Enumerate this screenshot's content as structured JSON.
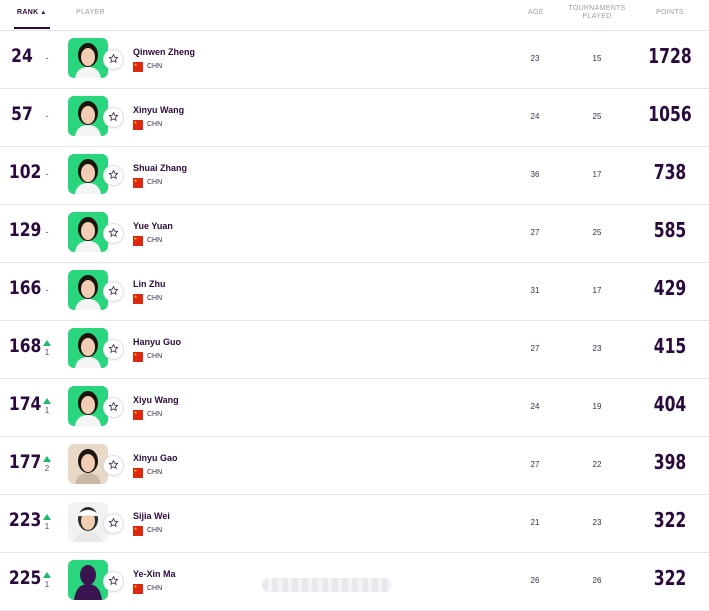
{
  "header": {
    "rank": "RANK",
    "player": "PLAYER",
    "age": "AGE",
    "tournaments_line1": "TOURNAMENTS",
    "tournaments_line2": "PLAYED",
    "points": "POINTS",
    "sort_icon": "caret-up-icon"
  },
  "colors": {
    "primary_text": "#2b0a3d",
    "green_photo_bg": "#2ad67d",
    "up_arrow": "#1fb86b",
    "flag_red": "#de2910",
    "flag_yellow": "#ffde00"
  },
  "rows": [
    {
      "rank": "24",
      "move": "-",
      "dir": "none",
      "name": "Qinwen Zheng",
      "country": "CHN",
      "age": "23",
      "tournaments": "15",
      "points": "1728",
      "photo": "green"
    },
    {
      "rank": "57",
      "move": "-",
      "dir": "none",
      "name": "Xinyu Wang",
      "country": "CHN",
      "age": "24",
      "tournaments": "25",
      "points": "1056",
      "photo": "green"
    },
    {
      "rank": "102",
      "move": "-",
      "dir": "none",
      "name": "Shuai Zhang",
      "country": "CHN",
      "age": "36",
      "tournaments": "17",
      "points": "738",
      "photo": "green"
    },
    {
      "rank": "129",
      "move": "-",
      "dir": "none",
      "name": "Yue Yuan",
      "country": "CHN",
      "age": "27",
      "tournaments": "25",
      "points": "585",
      "photo": "green"
    },
    {
      "rank": "166",
      "move": "-",
      "dir": "none",
      "name": "Lin Zhu",
      "country": "CHN",
      "age": "31",
      "tournaments": "17",
      "points": "429",
      "photo": "green"
    },
    {
      "rank": "168",
      "move": "1",
      "dir": "up",
      "name": "Hanyu Guo",
      "country": "CHN",
      "age": "27",
      "tournaments": "23",
      "points": "415",
      "photo": "green"
    },
    {
      "rank": "174",
      "move": "1",
      "dir": "up",
      "name": "Xiyu Wang",
      "country": "CHN",
      "age": "24",
      "tournaments": "19",
      "points": "404",
      "photo": "green"
    },
    {
      "rank": "177",
      "move": "2",
      "dir": "up",
      "name": "Xinyu Gao",
      "country": "CHN",
      "age": "27",
      "tournaments": "22",
      "points": "398",
      "photo": "plain"
    },
    {
      "rank": "223",
      "move": "1",
      "dir": "up",
      "name": "Sijia Wei",
      "country": "CHN",
      "age": "21",
      "tournaments": "23",
      "points": "322",
      "photo": "white"
    },
    {
      "rank": "225",
      "move": "1",
      "dir": "up",
      "name": "Ye-Xin Ma",
      "country": "CHN",
      "age": "26",
      "tournaments": "26",
      "points": "322",
      "photo": "silhouette"
    }
  ]
}
